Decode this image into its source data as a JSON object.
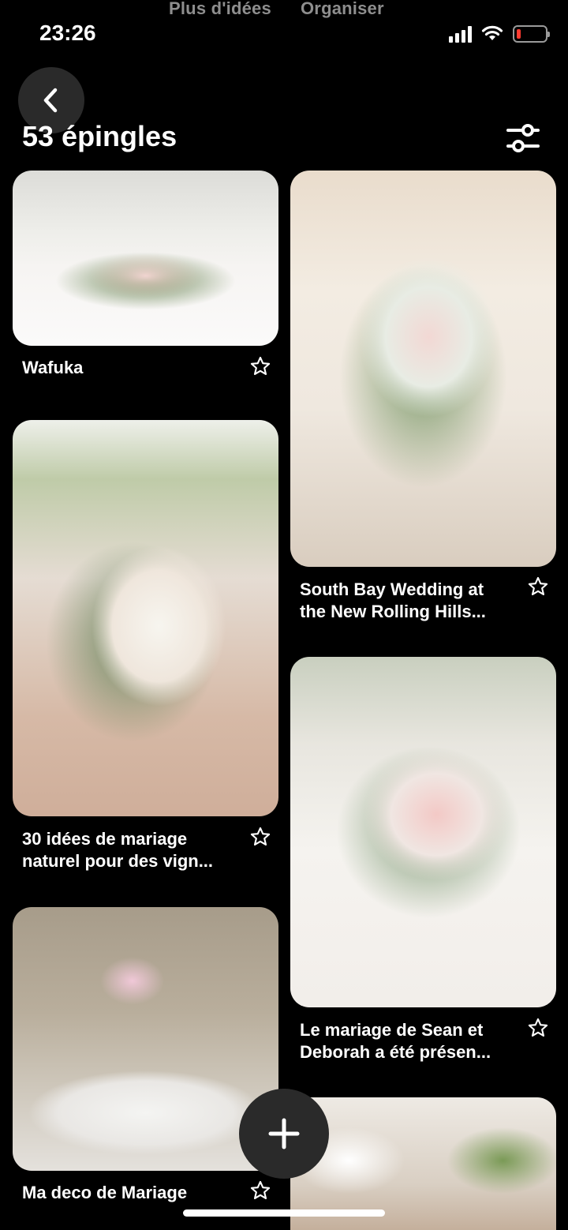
{
  "top_tabs": {
    "more_ideas": "Plus d'idées",
    "organize": "Organiser"
  },
  "status_bar": {
    "time": "23:26",
    "battery_level": 0.14,
    "battery_color": "#ff3b30"
  },
  "header": {
    "back_icon": "chevron-left-icon",
    "pins_count": "53 épingles",
    "filter_icon": "sliders-icon"
  },
  "pins": [
    {
      "title": "Wafuka",
      "image": "floral table garland with pink roses"
    },
    {
      "title": "South Bay Wedding at the New Rolling Hills...",
      "image": "tall white and blush floral centerpiece"
    },
    {
      "title": "30 idées de mariage naturel pour des vign...",
      "image": "table 10 centerpiece with hydrangeas in wooden box"
    },
    {
      "title": "Le mariage de Sean et Deborah a été présen...",
      "image": "blush roses in wooden box centerpiece"
    },
    {
      "title": "Ma deco de Mariage",
      "image": "reception tables with candelabra centerpiece"
    },
    {
      "title": "",
      "image": "arched hall with white flowers"
    }
  ],
  "fab": {
    "icon": "plus-icon"
  },
  "colors": {
    "background": "#000000",
    "button_bg": "#2a2a2a",
    "faded_text": "#8e8e8e"
  }
}
